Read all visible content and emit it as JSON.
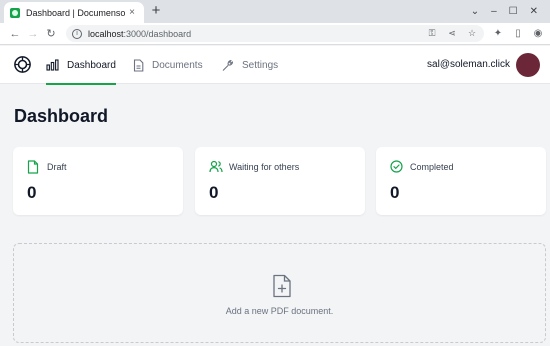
{
  "browser": {
    "tab_title": "Dashboard | Documenso",
    "tab_close": "×",
    "new_tab": "+",
    "url_host": "localhost",
    "url_path": ":3000/dashboard",
    "window_controls": [
      "⌄",
      "–",
      "☐",
      "✕"
    ]
  },
  "nav": {
    "items": [
      {
        "label": "Dashboard",
        "icon": "bar-chart-icon",
        "active": true
      },
      {
        "label": "Documents",
        "icon": "document-icon",
        "active": false
      },
      {
        "label": "Settings",
        "icon": "wrench-icon",
        "active": false
      }
    ],
    "user_email": "sal@soleman.click",
    "avatar_color": "#6b2737"
  },
  "page": {
    "title": "Dashboard"
  },
  "stats": [
    {
      "label": "Draft",
      "count": "0",
      "icon": "file-icon"
    },
    {
      "label": "Waiting for others",
      "count": "0",
      "icon": "users-icon"
    },
    {
      "label": "Completed",
      "count": "0",
      "icon": "check-circle-icon"
    }
  ],
  "upload": {
    "text": "Add a new PDF document."
  },
  "colors": {
    "accent": "#16a34a",
    "background": "#f3f4f6"
  }
}
